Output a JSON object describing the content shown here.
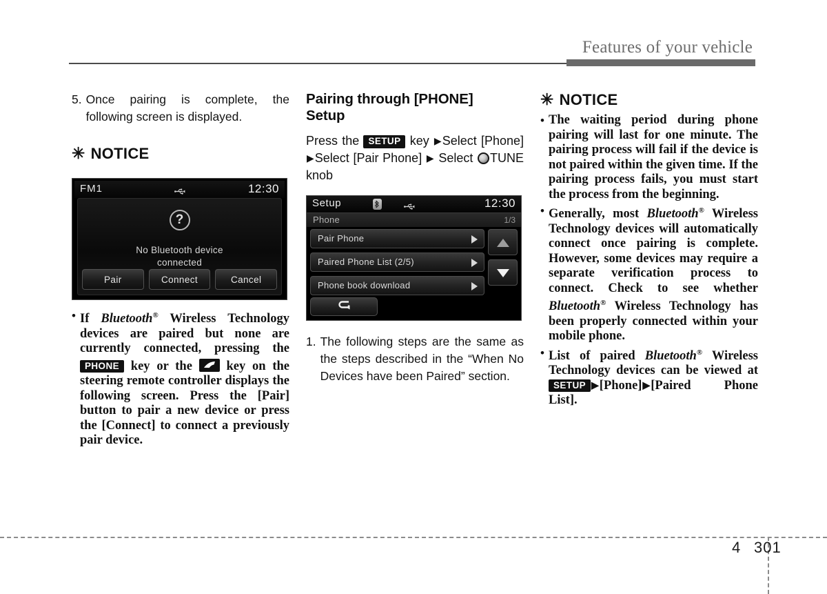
{
  "header": {
    "title": "Features of your vehicle"
  },
  "footer": {
    "chapter": "4",
    "page": "301"
  },
  "left_column": {
    "step": {
      "number": "5.",
      "text": "Once pairing is complete, the following screen is displayed."
    },
    "notice_heading": "NOTICE",
    "asterisk": "✳",
    "radio_screen": {
      "source_label": "FM1",
      "clock": "12:30",
      "usb_icon": "usb-icon",
      "question_icon": "?",
      "message_line1": "No Bluetooth device",
      "message_line2": "connected",
      "buttons": [
        "Pair",
        "Connect",
        "Cancel"
      ]
    },
    "bullets": [
      {
        "parts": [
          {
            "t": "text",
            "v": "If "
          },
          {
            "t": "italic",
            "v": "Bluetooth"
          },
          {
            "t": "sup",
            "v": "®"
          },
          {
            "t": "text",
            "v": " Wireless Technology devices are paired but none are currently connected, pressing the "
          },
          {
            "t": "keycap",
            "v": "PHONE"
          },
          {
            "t": "text",
            "v": " key or the "
          },
          {
            "t": "phoneicon",
            "v": "phone-handset-icon"
          },
          {
            "t": "text",
            "v": " key on the steering remote controller displays the following screen. Press the [Pair] button to pair a new device or press the [Connect] to connect a previously pair device."
          }
        ]
      }
    ]
  },
  "middle_column": {
    "section_title_line1": "Pairing through [PHONE]",
    "section_title_line2": "Setup",
    "instruction_parts": [
      {
        "t": "text",
        "v": "Press the "
      },
      {
        "t": "keycap",
        "v": "SETUP"
      },
      {
        "t": "text",
        "v": " key "
      },
      {
        "t": "arrow",
        "v": "▶"
      },
      {
        "t": "text",
        "v": "Select [Phone]"
      },
      {
        "t": "arrow",
        "v": "▶"
      },
      {
        "t": "text",
        "v": "Select [Pair Phone] "
      },
      {
        "t": "arrow",
        "v": "▶"
      },
      {
        "t": "text",
        "v": " Select "
      },
      {
        "t": "knob",
        "v": "tune-knob-icon"
      },
      {
        "t": "text",
        "v": "TUNE knob"
      }
    ],
    "setup_screen": {
      "title": "Setup",
      "bluetooth_icon": "bluetooth-icon",
      "usb_icon": "usb-icon",
      "clock": "12:30",
      "subheader_label": "Phone",
      "subheader_page": "1/3",
      "menu_items": [
        {
          "label": "Pair Phone",
          "arrow": "chevron-right-icon"
        },
        {
          "label": "Paired Phone List  (2/5)",
          "arrow": "chevron-right-icon"
        },
        {
          "label": "Phone book download",
          "arrow": "chevron-right-icon"
        }
      ],
      "scroll_up": "scroll-up-icon",
      "scroll_down": "scroll-down-icon",
      "back_button": "back-arrow-icon"
    },
    "step": {
      "number": "1.",
      "text": "The following steps are the same as the steps described in the “When No Devices have been Paired” section."
    }
  },
  "right_column": {
    "notice_heading": "NOTICE",
    "asterisk": "✳",
    "bullets": [
      {
        "parts": [
          {
            "t": "text",
            "v": "The waiting period during phone pairing will last for one minute. The pairing process will fail if the device is not paired within the given time. If the pairing process fails, you must start the process from the beginning."
          }
        ]
      },
      {
        "parts": [
          {
            "t": "text",
            "v": "Generally, most "
          },
          {
            "t": "italic",
            "v": "Bluetooth"
          },
          {
            "t": "sup",
            "v": "®"
          },
          {
            "t": "text",
            "v": " Wireless Technology devices will automatically connect once pairing is complete. However, some devices may require a separate verification process to connect. Check to see whether "
          },
          {
            "t": "italic",
            "v": "Bluetooth"
          },
          {
            "t": "sup",
            "v": "®"
          },
          {
            "t": "text",
            "v": " Wireless Technology has been properly connected within your mobile phone."
          }
        ]
      },
      {
        "parts": [
          {
            "t": "text",
            "v": "List of paired "
          },
          {
            "t": "italic",
            "v": "Bluetooth"
          },
          {
            "t": "sup",
            "v": "®"
          },
          {
            "t": "text",
            "v": " Wireless Technology devices can be viewed at "
          },
          {
            "t": "keycap",
            "v": "SETUP"
          },
          {
            "t": "arrow",
            "v": "▶"
          },
          {
            "t": "text",
            "v": "[Phone]"
          },
          {
            "t": "arrow",
            "v": "▶"
          },
          {
            "t": "text",
            "v": "[Paired Phone List]."
          }
        ]
      }
    ]
  },
  "colors": {
    "header_rule": "#4c4c4c",
    "header_band": "#6a6a6a",
    "header_text": "#6d6d6d",
    "body_text": "#131313",
    "screen_bg": "#000000"
  }
}
